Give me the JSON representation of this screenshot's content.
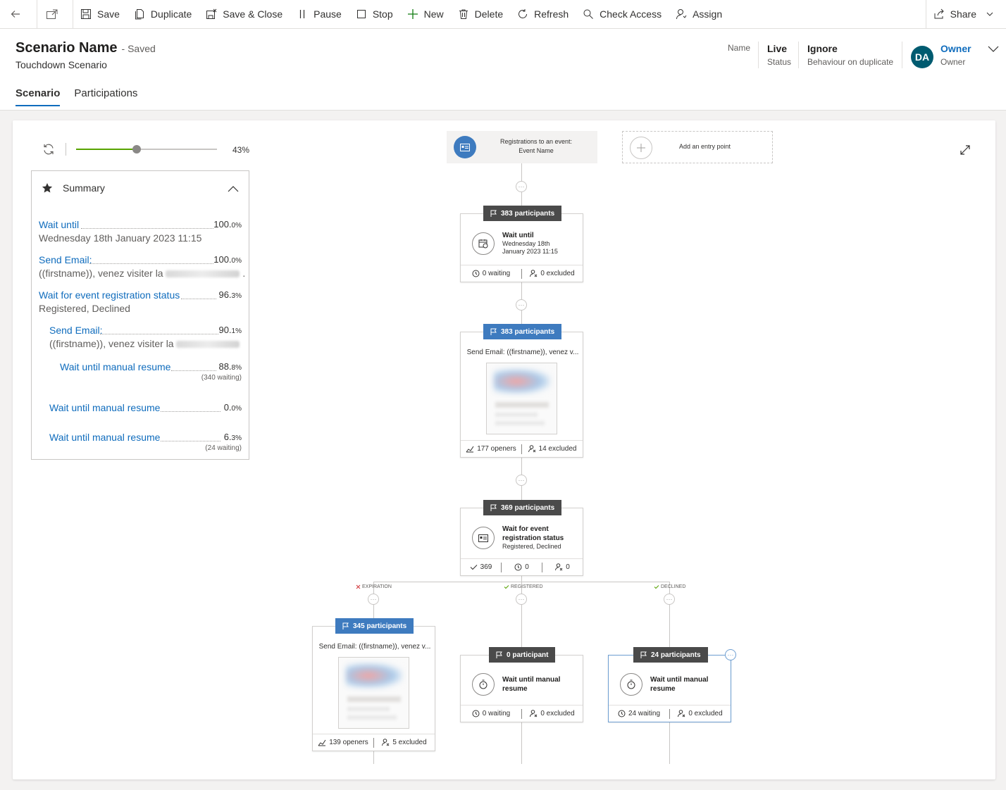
{
  "toolbar": {
    "save": "Save",
    "duplicate": "Duplicate",
    "save_close": "Save & Close",
    "pause": "Pause",
    "stop": "Stop",
    "new": "New",
    "delete": "Delete",
    "refresh": "Refresh",
    "check_access": "Check Access",
    "assign": "Assign",
    "share": "Share"
  },
  "header": {
    "title": "Scenario Name",
    "saved": "- Saved",
    "subtitle": "Touchdown Scenario",
    "name_label": "Name",
    "status_value": "Live",
    "status_label": "Status",
    "behaviour_value": "Ignore",
    "behaviour_label": "Behaviour on duplicate",
    "owner_initials": "DA",
    "owner_value": "Owner",
    "owner_label": "Owner"
  },
  "tabs": [
    "Scenario",
    "Participations"
  ],
  "zoom": {
    "percent_label": "43%",
    "level": 0.43
  },
  "summary": {
    "title": "Summary",
    "items": [
      {
        "label": "Wait until",
        "sub": "Wednesday 18th January 2023 11:15",
        "pct_main": "100.",
        "pct_dec": "0%"
      },
      {
        "label": "Send Email:",
        "sub": "((firstname)), venez visiter la",
        "pct_main": "100.",
        "pct_dec": "0%"
      },
      {
        "label": "Wait for event registration status",
        "sub": "Registered, Declined",
        "pct_main": "96.",
        "pct_dec": "3%"
      },
      {
        "label": "Send Email:",
        "sub": "((firstname)), venez visiter la",
        "pct_main": "90.",
        "pct_dec": "1%"
      },
      {
        "label": "Wait until manual resume",
        "pct_main": "88.",
        "pct_dec": "8%",
        "waiting": "(340 waiting)"
      },
      {
        "label": "Wait until manual resume",
        "pct_main": "0.",
        "pct_dec": "0%"
      },
      {
        "label": "Wait until manual resume",
        "pct_main": "6.",
        "pct_dec": "3%",
        "waiting": "(24 waiting)"
      }
    ]
  },
  "flow": {
    "entry": {
      "line1": "Registrations to an event:",
      "line2": "Event Name"
    },
    "add_entry": "Add an entry point",
    "node1": {
      "badge": "383 participants",
      "title": "Wait until",
      "sub1": "Wednesday 18th",
      "sub2": "January 2023 11:15",
      "f1": "0 waiting",
      "f2": "0 excluded"
    },
    "node2": {
      "badge": "383 participants",
      "title": "Send Email: ((firstname)), venez v...",
      "f1": "177 openers",
      "f2": "14 excluded"
    },
    "node3": {
      "badge": "369 participants",
      "title1": "Wait for event",
      "title2": "registration status",
      "sub": "Registered, Declined",
      "f1": "369",
      "f2": "0",
      "f3": "0"
    },
    "branches": {
      "b1": "EXPIRATION",
      "b2": "REGISTERED",
      "b3": "DECLINED"
    },
    "node4": {
      "badge": "345 participants",
      "title": "Send Email: ((firstname)), venez v...",
      "f1": "139 openers",
      "f2": "5 excluded"
    },
    "node5": {
      "badge": "0 participant",
      "title1": "Wait until manual",
      "title2": "resume",
      "f1": "0 waiting",
      "f2": "0 excluded"
    },
    "node6": {
      "badge": "24 participants",
      "title1": "Wait until manual",
      "title2": "resume",
      "f1": "24 waiting",
      "f2": "0 excluded"
    }
  },
  "colors": {
    "accent": "#0f6cbd",
    "slider": "#57a300",
    "badge_dark": "#4a4a4a",
    "badge_blue": "#3e7bbf",
    "avatar": "#005b70"
  }
}
